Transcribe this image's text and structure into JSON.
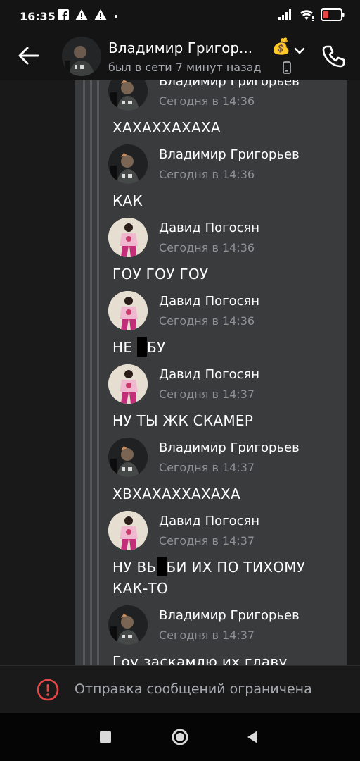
{
  "status_bar": {
    "time": "16:35"
  },
  "header": {
    "contact_name": "Владимир Григор...",
    "emoji": "💰",
    "last_seen": "был в сети 7 минут назад"
  },
  "messages": [
    {
      "author": "Владимир Григорьев",
      "time": "Сегодня в 14:36",
      "text": "ХАХАХХАХАХА",
      "avatar": "vlad"
    },
    {
      "author": "Владимир Григорьев",
      "time": "Сегодня в 14:36",
      "text": "КАК",
      "avatar": "vlad"
    },
    {
      "author": "Давид Погосян",
      "time": "Сегодня в 14:36",
      "text": "ГОУ ГОУ ГОУ",
      "avatar": "david"
    },
    {
      "author": "Давид Погосян",
      "time": "Сегодня в 14:36",
      "text_before": "НЕ ",
      "text_after": "БУ",
      "avatar": "david"
    },
    {
      "author": "Давид Погосян",
      "time": "Сегодня в 14:37",
      "text": "НУ ТЫ ЖК СКАМЕР",
      "avatar": "david"
    },
    {
      "author": "Владимир Григорьев",
      "time": "Сегодня в 14:37",
      "text": "ХВХАХАХХАХАХА",
      "avatar": "vlad"
    },
    {
      "author": "Давид Погосян",
      "time": "Сегодня в 14:37",
      "text_before": "НУ ВЬ",
      "text_after": "БИ ИХ ПО ТИХОМУ КАК-ТО",
      "avatar": "david"
    },
    {
      "author": "Владимир Григорьев",
      "time": "Сегодня в 14:37",
      "text": "Гоу заскамлю их главу",
      "avatar": "vlad"
    }
  ],
  "restriction": {
    "text": "Отправка сообщений ограничена",
    "icon": "warning-circle-icon",
    "color": "#e64646"
  },
  "navbar": {
    "icons": [
      "recents-square-icon",
      "home-circle-icon",
      "back-triangle-icon"
    ]
  }
}
